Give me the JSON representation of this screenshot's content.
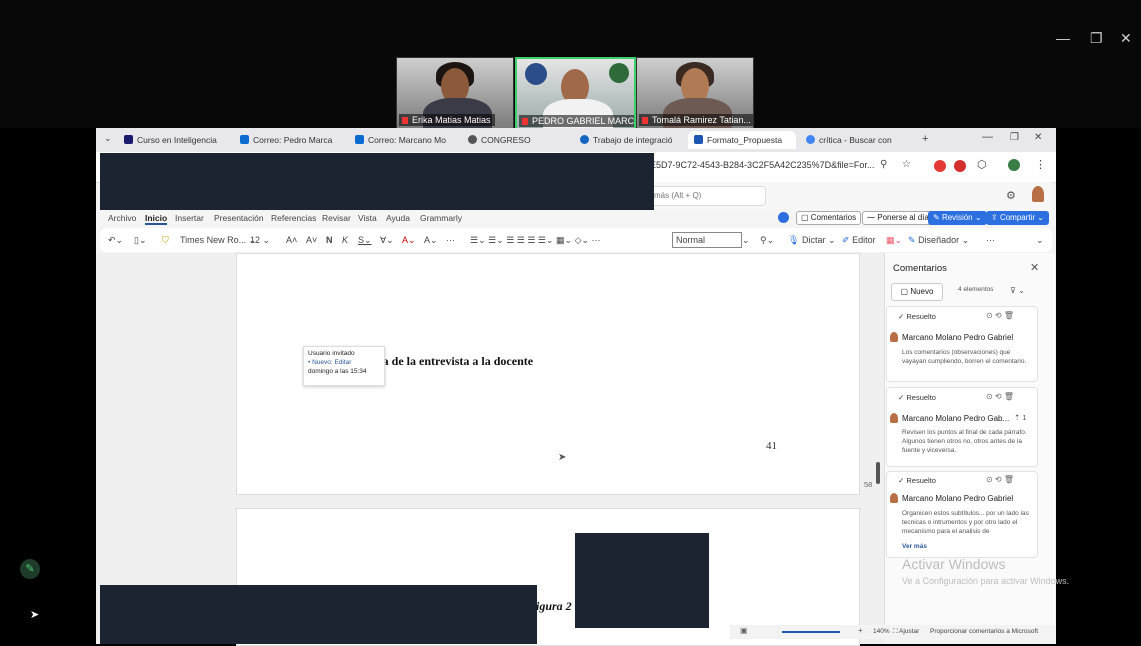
{
  "meeting": {
    "participants": [
      {
        "name": "Erika Matias Matias"
      },
      {
        "name": "PEDRO GABRIEL MARCA..."
      },
      {
        "name": "Tomalá Ramirez Tatian..."
      }
    ]
  },
  "window_controls": {
    "minimize": "—",
    "restore": "❐",
    "close": "✕"
  },
  "browser": {
    "tabs": [
      {
        "label": "Curso en Inteligencia",
        "color": "#1a1a6e"
      },
      {
        "label": "Correo: Pedro Marca",
        "color": "#0b6bd1"
      },
      {
        "label": "Correo: Marcano Mo",
        "color": "#0b6bd1"
      },
      {
        "label": "CONGRESO",
        "color": "#555555"
      },
      {
        "label": "Trabajo de integració",
        "color": "#1565c0"
      },
      {
        "label": "Formato_Propuesta",
        "color": "#1e56b4"
      },
      {
        "label": "crítica - Buscar con",
        "color": "#4285f4"
      }
    ],
    "url_fragment": "E5D7-9C72-4543-B284-3C2F5A42C235%7D&file=For..."
  },
  "word": {
    "search_hint": "más (Alt + Q)",
    "ribbon_tabs": [
      "Archivo",
      "Inicio",
      "Insertar",
      "Presentación",
      "Referencias",
      "Revisar",
      "Vista",
      "Ayuda",
      "Grammarly"
    ],
    "ribbon_buttons": {
      "comentarios": "Comentarios",
      "ponerse": "Ponerse al día",
      "revision": "Revisión",
      "compartir": "Compartir"
    },
    "toolbar": {
      "font": "Times New Ro...",
      "size": "12",
      "style": "Normal",
      "dictar": "Dictar",
      "editor": "Editor",
      "disenador": "Diseñador"
    }
  },
  "document": {
    "heading_fragment": "ica de la entrevista a la docente",
    "page_number": "41",
    "line_indicator": "58",
    "figure_fragment": "igura 2",
    "tooltip": {
      "user": "Usuario invitado",
      "state": "• Nuevo: Editar",
      "when": "domingo a las 15:34"
    }
  },
  "comments": {
    "title": "Comentarios",
    "new_label": "Nuevo",
    "count_label": "4 elementos",
    "items": [
      {
        "status": "Resuelto",
        "author": "Marcano Molano Pedro Gabriel",
        "body": "Los comentarios (observaciones) que vayayan cumpliendo, borren el comentario."
      },
      {
        "status": "Resuelto",
        "author": "Marcano Molano Pedro Gab...",
        "replies": "1",
        "body": "Revisen los puntos al final de cada párrafo. Algunos tienen otros no, otros antes de la fuente y viceversa."
      },
      {
        "status": "Resuelto",
        "author": "Marcano Molano Pedro Gabriel",
        "body": "Organicen estos subtítulos... por un lado las tecnicas o intrumentos y por otro lado el mecanismo para el analisis de",
        "more": "Ver más"
      }
    ]
  },
  "status_bar": {
    "zoom": "140%",
    "fit": "Ajustar",
    "feedback": "Proporcionar comentarios a Microsoft"
  },
  "watermark": {
    "title": "Activar Windows",
    "subtitle": "Ve a Configuración para activar Windows."
  }
}
